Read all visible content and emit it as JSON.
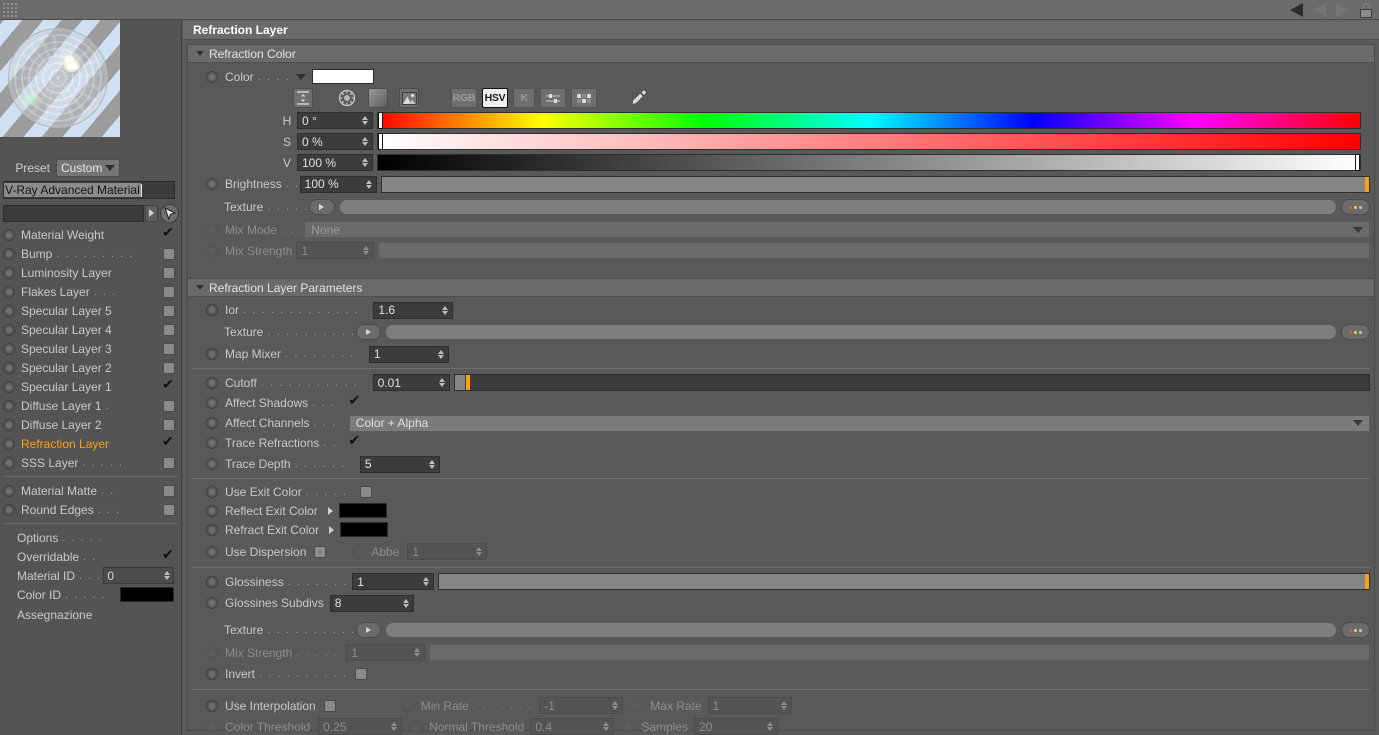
{
  "window": {
    "panel_title": "Refraction Layer",
    "topbar_icons": [
      "grip-dots",
      "nav-back-arrow",
      "nav-forward-arrow",
      "lock-icon"
    ]
  },
  "sidebar": {
    "preview": {
      "name": "material-preview-sphere"
    },
    "preset": {
      "label": "Preset",
      "value": "Custom"
    },
    "material_name": "V-Ray Advanced Material",
    "path_value": "",
    "layers": [
      {
        "label": "Material Weight",
        "dots": "",
        "checked": true
      },
      {
        "label": "Bump",
        "dots": ". . . . . . . . .",
        "checked": false
      },
      {
        "label": "Luminosity Layer",
        "dots": "",
        "checked": false
      },
      {
        "label": "Flakes Layer",
        "dots": ". . .",
        "checked": false
      },
      {
        "label": "Specular Layer 5",
        "dots": "",
        "checked": false
      },
      {
        "label": "Specular Layer 4",
        "dots": "",
        "checked": false
      },
      {
        "label": "Specular Layer 3",
        "dots": "",
        "checked": false
      },
      {
        "label": "Specular Layer 2",
        "dots": "",
        "checked": false
      },
      {
        "label": "Specular Layer 1",
        "dots": "",
        "checked": true
      },
      {
        "label": "Diffuse Layer 1",
        "dots": ".",
        "checked": false
      },
      {
        "label": "Diffuse Layer 2",
        "dots": "",
        "checked": false
      },
      {
        "label": "Refraction Layer",
        "dots": "",
        "checked": true,
        "active": true
      },
      {
        "label": "SSS Layer",
        "dots": ". . . . .",
        "checked": false
      }
    ],
    "extras": [
      {
        "label": "Material Matte",
        "dots": ". .",
        "checked": false
      },
      {
        "label": "Round Edges",
        "dots": ". . .",
        "checked": false
      }
    ],
    "options": {
      "title": "Options",
      "title_dots": ". . . . .",
      "overridable_label": "Overridable",
      "overridable_dots": ". .",
      "overridable_checked": true,
      "material_id_label": "Material ID",
      "material_id_dots": ". . .",
      "material_id_value": "0",
      "color_id_label": "Color ID",
      "color_id_dots": ". . . . .",
      "color_id_value": "#000000"
    },
    "assignment_label": "Assegnazione"
  },
  "refraction_color": {
    "group_title": "Refraction Color",
    "color_row": {
      "label": "Color",
      "dots": ". . . .",
      "swatch": "#ffffff"
    },
    "mode_buttons": [
      {
        "name": "range-icon",
        "label": ""
      },
      {
        "name": "color-wheel-icon",
        "label": ""
      },
      {
        "name": "gradient-icon",
        "label": ""
      },
      {
        "name": "image-picker-icon",
        "label": ""
      }
    ],
    "model_buttons": [
      {
        "label": "RGB",
        "selected": false
      },
      {
        "label": "HSV",
        "selected": true
      },
      {
        "label": "K",
        "selected": false
      },
      {
        "label": "sliders-icon",
        "selected": false
      },
      {
        "label": "swatches-icon",
        "selected": false
      }
    ],
    "eyedropper": "eyedropper-icon",
    "hsv": [
      {
        "label": "H",
        "value": "0 °",
        "knob_pct": 0
      },
      {
        "label": "S",
        "value": "0 %",
        "knob_pct": 0
      },
      {
        "label": "V",
        "value": "100 %",
        "knob_pct": 100
      }
    ],
    "brightness": {
      "label": "Brightness",
      "dots": ". .",
      "value": "100 %",
      "fill_pct": 100
    },
    "texture": {
      "label": "Texture",
      "dots": ". . . . .",
      "value": "",
      "more_label": "..."
    },
    "mix_mode": {
      "label": "Mix Mode",
      "dots": ". . .",
      "value": "None"
    },
    "mix_strength": {
      "label": "Mix Strength",
      "dots": "",
      "value": "1",
      "fill_pct": 100
    }
  },
  "refraction_params": {
    "group_title": "Refraction Layer Parameters",
    "ior": {
      "label": "Ior",
      "dots": ". . . . . . . . . . . . .",
      "value": "1.6"
    },
    "ior_texture": {
      "label": "Texture",
      "dots": ". . . . . . . . . .",
      "value": "",
      "more_label": "..."
    },
    "map_mixer": {
      "label": "Map Mixer",
      "dots": ". . . . . . . .",
      "value": "1"
    },
    "cutoff": {
      "label": "Cutoff",
      "dots": ". . . . . . . . . . .",
      "value": "0.01",
      "fill_pct": 1.5
    },
    "affect_shadows": {
      "label": "Affect Shadows",
      "dots": ". . .",
      "checked": true
    },
    "affect_channels": {
      "label": "Affect Channels",
      "dots": ". . .",
      "value": "Color + Alpha"
    },
    "trace_refractions": {
      "label": "Trace Refractions",
      "dots": ". .",
      "checked": true
    },
    "trace_depth": {
      "label": "Trace Depth",
      "dots": ". . . . . .",
      "value": "5"
    },
    "use_exit_color": {
      "label": "Use Exit Color",
      "dots": ". . . . .",
      "checked": false
    },
    "reflect_exit_color": {
      "label": "Reflect Exit Color",
      "dots": "",
      "swatch": "#000000"
    },
    "refract_exit_color": {
      "label": "Refract Exit Color",
      "dots": "",
      "swatch": "#000000"
    },
    "use_dispersion": {
      "label": "Use Dispersion",
      "dots": "",
      "checked": false
    },
    "abbe": {
      "label": "Abbe",
      "dots": "",
      "value": "1"
    },
    "glossiness": {
      "label": "Glossiness",
      "dots": ". . . . . . .",
      "value": "1",
      "fill_pct": 100
    },
    "glossiness_subdivs": {
      "label": "Glossines Subdivs",
      "dots": "",
      "value": "8"
    },
    "gloss_texture": {
      "label": "Texture",
      "dots": ". . . . . . . . . .",
      "value": "",
      "more_label": "..."
    },
    "gloss_mix_strength": {
      "label": "Mix Strength",
      "dots": ". . . . .",
      "value": "1",
      "fill_pct": 100
    },
    "invert": {
      "label": "Invert",
      "dots": ". . . . . . . . . .",
      "checked": false
    },
    "use_interpolation": {
      "label": "Use Interpolation",
      "dots": "",
      "checked": false
    },
    "min_rate": {
      "label": "Min Rate",
      "dots": ". . . . . . .",
      "value": "-1"
    },
    "max_rate": {
      "label": "Max Rate",
      "dots": "",
      "value": "1"
    },
    "color_threshold": {
      "label": "Color Threshold",
      "dots": "",
      "value": "0.25"
    },
    "normal_threshold": {
      "label": "Normal Threshold",
      "dots": "",
      "value": "0.4"
    },
    "samples": {
      "label": "Samples",
      "dots": "",
      "value": "20"
    }
  },
  "colors": {
    "accent": "#ffa010",
    "panel_bg": "#5a5a5a",
    "header_bg": "#6a6a6a",
    "field_bg": "#3c3c3c"
  }
}
